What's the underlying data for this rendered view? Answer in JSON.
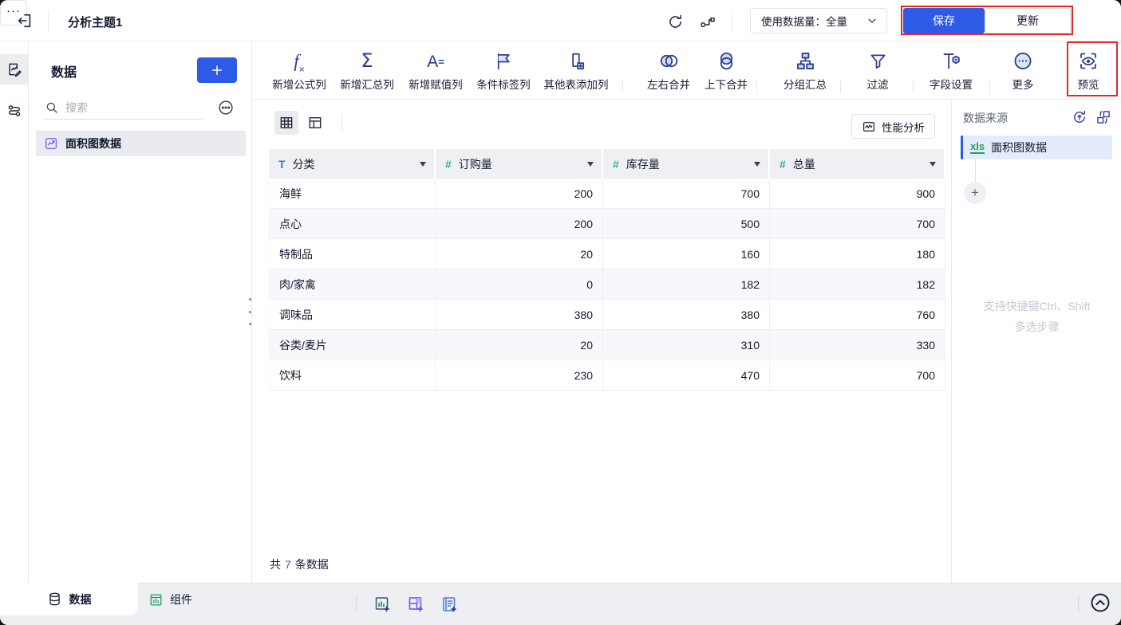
{
  "topbar": {
    "title": "分析主题1",
    "dataset_usage": "使用数据量：全量",
    "save_label": "保存",
    "update_label": "更新",
    "more_label": "···"
  },
  "sidebar": {
    "title": "数据",
    "search_placeholder": "搜索",
    "items": [
      {
        "label": "面积图数据",
        "icon": "area-chart-icon"
      }
    ]
  },
  "toolbar": {
    "items": [
      {
        "label": "新增公式列",
        "icon": "formula-column-icon"
      },
      {
        "label": "新增汇总列",
        "icon": "summary-column-icon"
      },
      {
        "label": "新增赋值列",
        "icon": "assign-column-icon"
      },
      {
        "label": "条件标签列",
        "icon": "condition-tag-column-icon"
      },
      {
        "label": "其他表添加列",
        "icon": "add-column-from-table-icon"
      },
      {
        "label": "左右合并",
        "icon": "merge-left-right-icon"
      },
      {
        "label": "上下合并",
        "icon": "merge-up-down-icon"
      },
      {
        "label": "分组汇总",
        "icon": "group-summary-icon"
      },
      {
        "label": "过滤",
        "icon": "filter-icon"
      },
      {
        "label": "字段设置",
        "icon": "field-settings-icon"
      },
      {
        "label": "更多",
        "icon": "more-circle-icon"
      },
      {
        "label": "预览",
        "icon": "preview-icon"
      }
    ]
  },
  "content": {
    "performance_label": "性能分析",
    "table": {
      "columns": [
        {
          "name": "分类",
          "type": "text"
        },
        {
          "name": "订购量",
          "type": "number"
        },
        {
          "name": "库存量",
          "type": "number"
        },
        {
          "name": "总量",
          "type": "number"
        }
      ],
      "rows": [
        [
          "海鲜",
          "200",
          "700",
          "900"
        ],
        [
          "点心",
          "200",
          "500",
          "700"
        ],
        [
          "特制品",
          "20",
          "160",
          "180"
        ],
        [
          "肉/家禽",
          "0",
          "182",
          "182"
        ],
        [
          "调味品",
          "380",
          "380",
          "760"
        ],
        [
          "谷类/麦片",
          "20",
          "310",
          "330"
        ],
        [
          "饮料",
          "230",
          "470",
          "700"
        ]
      ]
    },
    "footer": {
      "prefix": "共",
      "count": "7",
      "suffix": "条数据"
    }
  },
  "right_panel": {
    "title": "数据来源",
    "step": {
      "badge": "xls",
      "label": "面积图数据"
    },
    "hint_line1": "支持快捷键Ctrl、Shift",
    "hint_line2": "多选步骤"
  },
  "bottom_bar": {
    "tabs": [
      {
        "label": "数据",
        "icon": "database-icon"
      },
      {
        "label": "组件",
        "icon": "component-icon"
      }
    ]
  },
  "colors": {
    "accent": "#2e5be5",
    "annotation_red": "#e02a2a",
    "icon_navy": "#2d3c8f",
    "type_text_blue": "#3d6ef2",
    "type_number_teal": "#2ab5a5",
    "xls_green": "#1fa25b",
    "component_green": "#1c9e63",
    "dashboard_purple": "#7b61ff"
  }
}
